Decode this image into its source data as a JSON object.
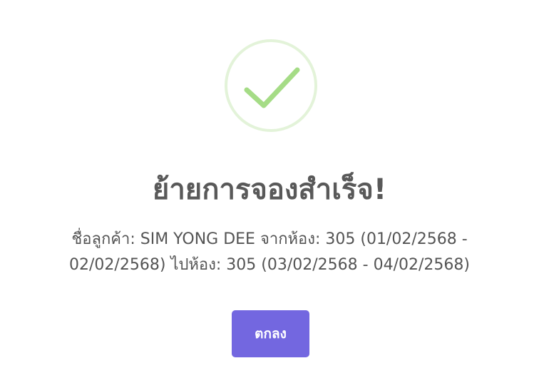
{
  "dialog": {
    "icon": "success-checkmark-icon",
    "title": "ย้ายการจองสำเร็จ!",
    "message": "ชื่อลูกค้า: SIM YONG DEE จากห้อง: 305 (01/02/2568 - 02/02/2568) ไปห้อง: 305 (03/02/2568 - 04/02/2568)",
    "confirm_label": "ตกลง"
  },
  "colors": {
    "success_ring": "#e3f3d9",
    "success_check": "#a5dc86",
    "title_text": "#595959",
    "message_text": "#545454",
    "confirm_button": "#7367e0",
    "confirm_text": "#ffffff"
  }
}
